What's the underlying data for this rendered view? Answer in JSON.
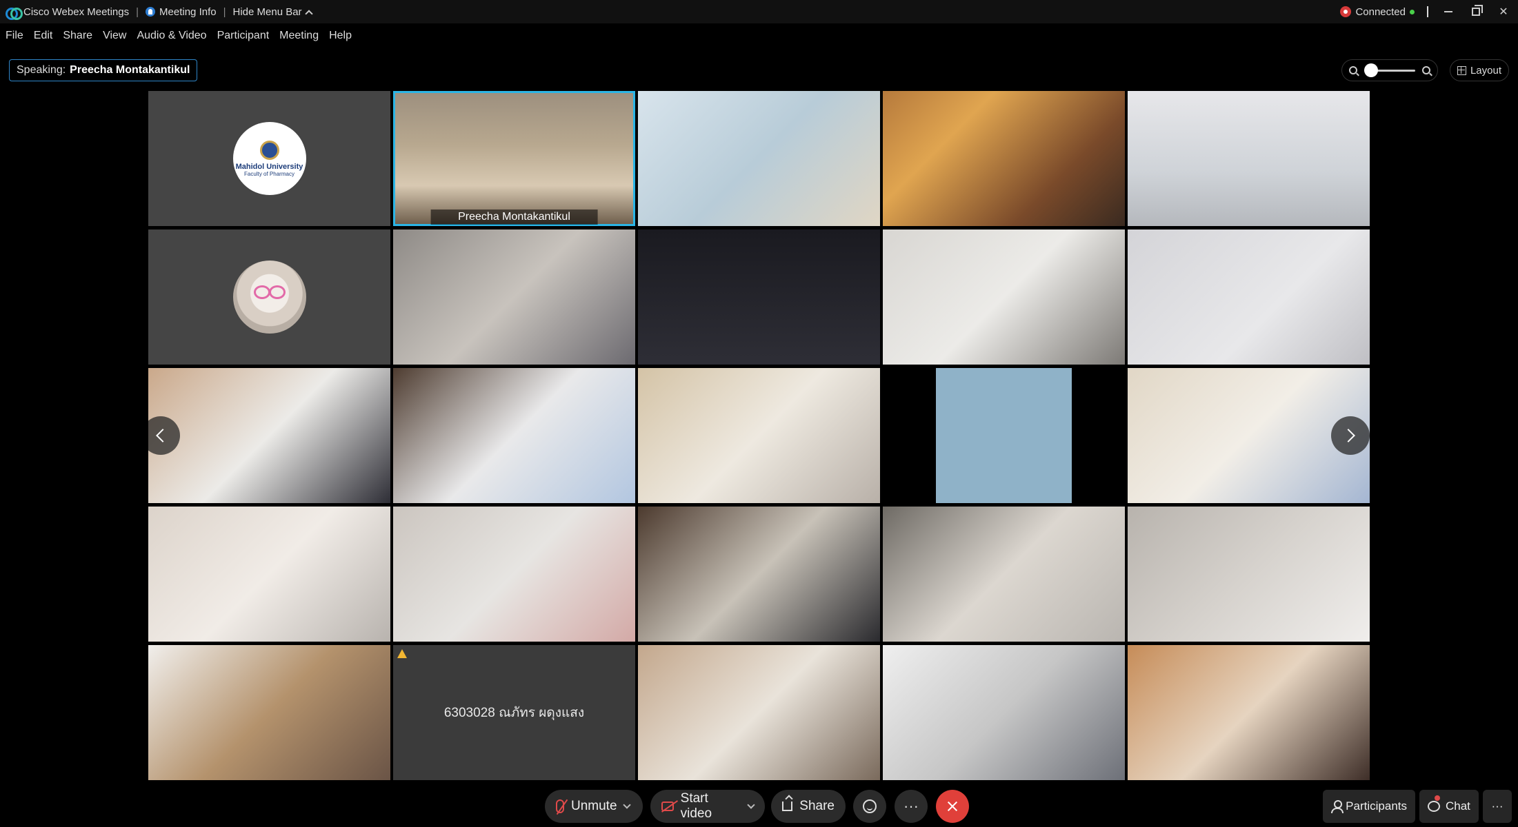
{
  "titlebar": {
    "app_name": "Cisco Webex Meetings",
    "meeting_info": "Meeting Info",
    "hide_menu": "Hide Menu Bar",
    "status": "Connected"
  },
  "menu": [
    "File",
    "Edit",
    "Share",
    "View",
    "Audio & Video",
    "Participant",
    "Meeting",
    "Help"
  ],
  "speaking": {
    "prefix": "Speaking:",
    "name": "Preecha Montakantikul"
  },
  "layout_label": "Layout",
  "zoom_level": 0,
  "tiles": {
    "logo_university": "Mahidol University",
    "logo_faculty": "Faculty of Pharmacy",
    "active_name": "Preecha Montakantikul",
    "text_participant": "6303028 ณภัทร ผดุงแสง"
  },
  "controls": {
    "unmute": "Unmute",
    "start_video": "Start video",
    "share": "Share",
    "more": "···",
    "participants": "Participants",
    "chat": "Chat",
    "overflow": "···"
  },
  "colors": {
    "accent_active": "#2bb5e6",
    "speaking_border": "#2f86c9",
    "end_button": "#e0403a",
    "muted_red": "#e04a4a",
    "connected_green": "#4ad04a"
  }
}
